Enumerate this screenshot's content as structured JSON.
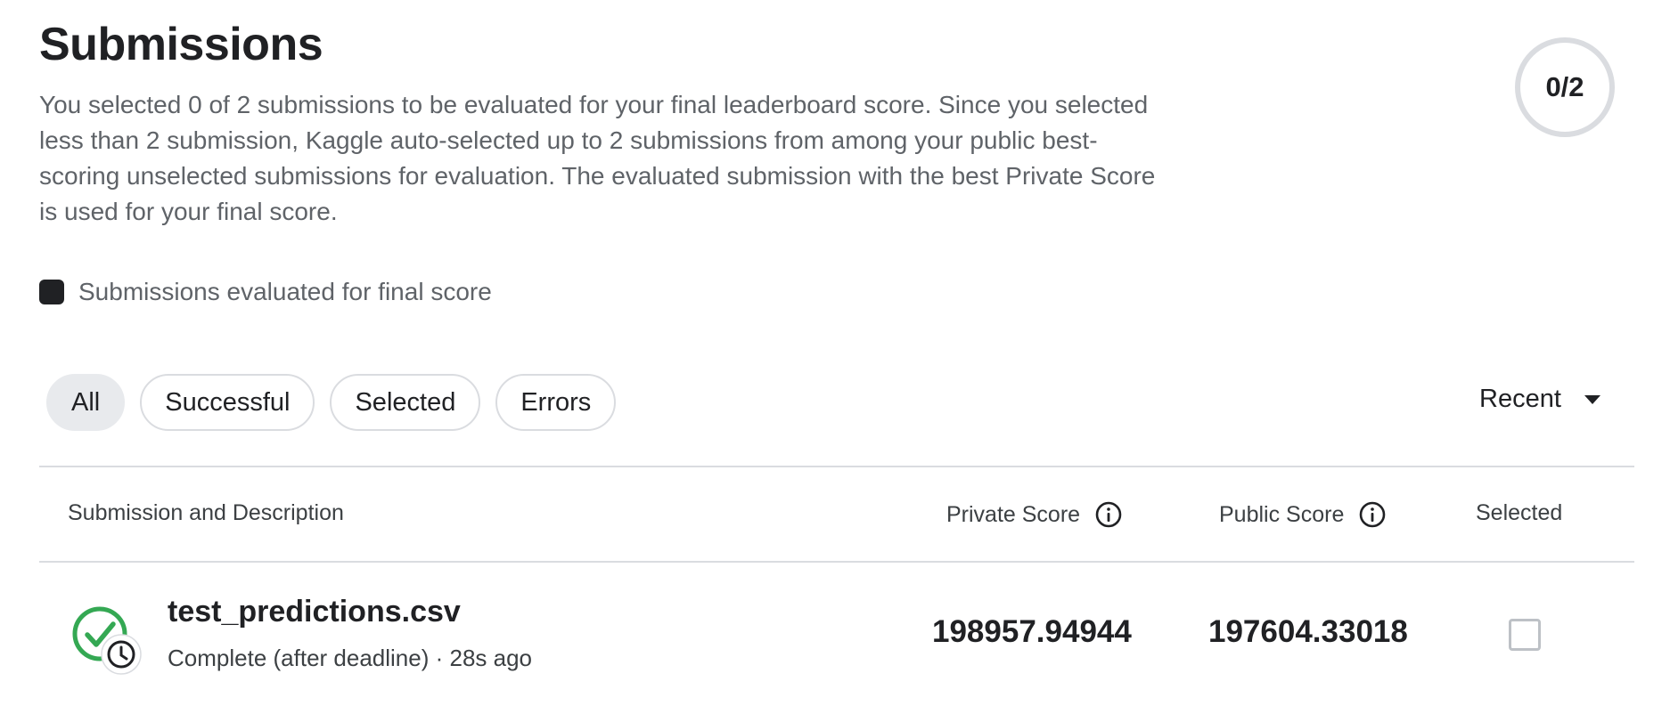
{
  "header": {
    "title": "Submissions",
    "description": "You selected 0 of 2 submissions to be evaluated for your final leaderboard score. Since you selected less than 2 submission, Kaggle auto-selected up to 2 submissions from among your public best-scoring unselected submissions for evaluation. The evaluated submission with the best Private Score is used for your final score.",
    "counter": "0/2"
  },
  "legend": {
    "label": "Submissions evaluated for final score",
    "swatch_color": "#202124"
  },
  "filters": {
    "chips": [
      {
        "label": "All",
        "active": true
      },
      {
        "label": "Successful",
        "active": false
      },
      {
        "label": "Selected",
        "active": false
      },
      {
        "label": "Errors",
        "active": false
      }
    ],
    "sort": {
      "label": "Recent",
      "icon": "caret-down-icon"
    }
  },
  "table": {
    "columns": {
      "submission": "Submission and Description",
      "private_score": "Private Score",
      "public_score": "Public Score",
      "selected": "Selected"
    },
    "rows": [
      {
        "file_name": "test_predictions.csv",
        "status": "Complete (after deadline) · 28s ago",
        "status_icon": "check-circle-clock-icon",
        "private_score": "198957.94944",
        "public_score": "197604.33018",
        "selected": false
      }
    ]
  },
  "colors": {
    "success": "#34a853",
    "text": "#202124",
    "muted": "#5f6368",
    "border": "#dadce0"
  }
}
